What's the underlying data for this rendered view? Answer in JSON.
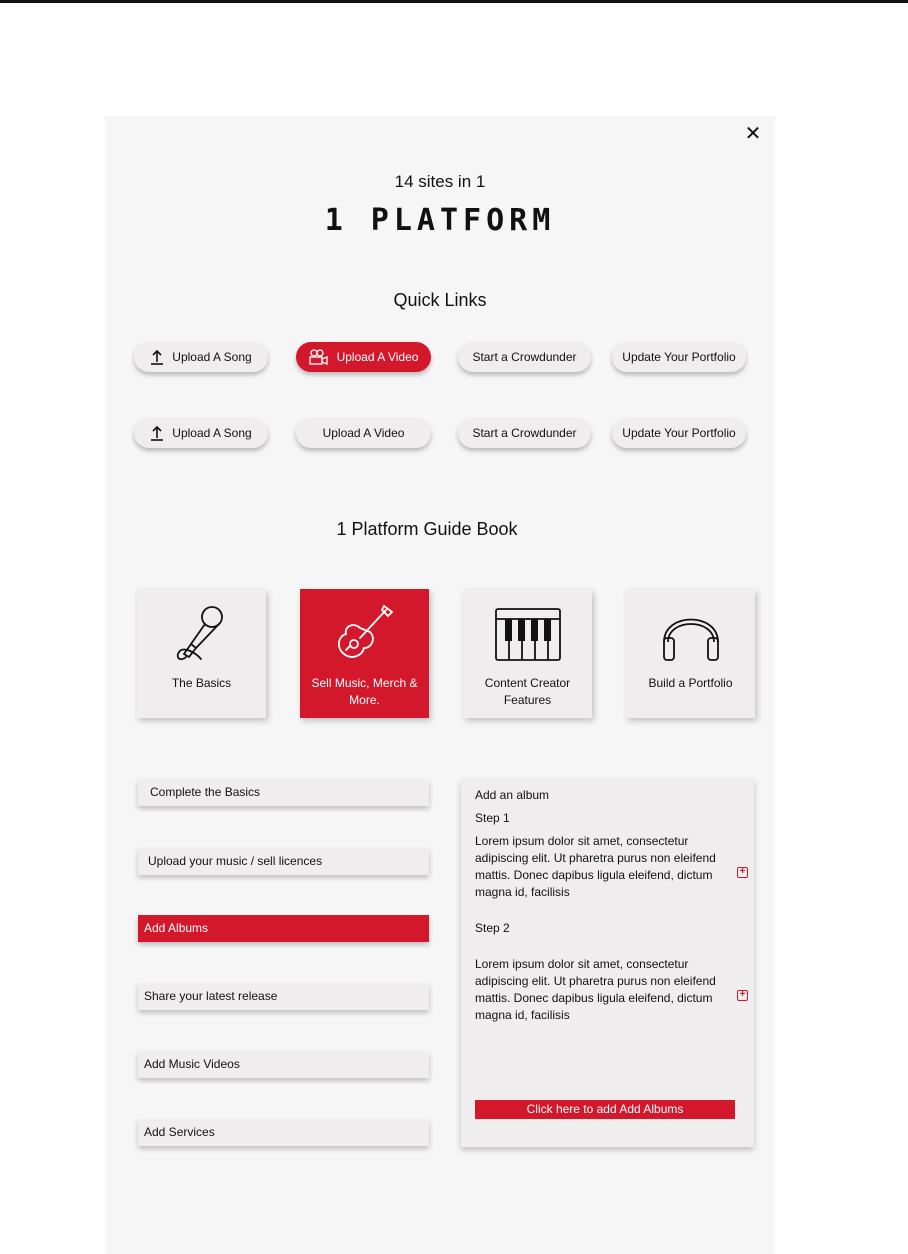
{
  "header": {
    "tagline": "14 sites in 1",
    "logo_text": "1 PLATFORM",
    "close_label": "✕"
  },
  "quick_links": {
    "title": "Quick Links",
    "row1": [
      {
        "label": "Upload A Song",
        "icon": "upload-icon"
      },
      {
        "label": "Upload A Video",
        "icon": "video-camera-icon",
        "active": true
      },
      {
        "label": "Start a Crowdunder"
      },
      {
        "label": "Update Your Portfolio"
      }
    ],
    "row2": [
      {
        "label": "Upload A Song",
        "icon": "upload-icon"
      },
      {
        "label": "Upload A Video"
      },
      {
        "label": "Start a Crowdunder"
      },
      {
        "label": "Update Your Portfolio"
      }
    ]
  },
  "guide": {
    "title": "1 Platform Guide Book",
    "cards": [
      {
        "label": "The Basics",
        "icon": "microphone-icon"
      },
      {
        "label": "Sell Music, Merch & More.",
        "icon": "guitar-icon",
        "active": true
      },
      {
        "label": "Content Creator Features",
        "icon": "piano-keys-icon"
      },
      {
        "label": "Build a Portfolio",
        "icon": "headphones-icon"
      }
    ]
  },
  "steps_menu": [
    {
      "label": "Complete the Basics"
    },
    {
      "label": "Upload your music / sell licences"
    },
    {
      "label": "Add Albums",
      "active": true
    },
    {
      "label": "Share your latest release"
    },
    {
      "label": "Add Music Videos"
    },
    {
      "label": "Add Services"
    }
  ],
  "detail": {
    "title": "Add an album",
    "step1_label": "Step 1",
    "step1_text": "Lorem ipsum dolor sit amet, consectetur adipiscing elit. Ut pharetra purus non eleifend mattis. Donec dapibus ligula eleifend, dictum magna id, facilisis",
    "step2_label": "Step 2",
    "step2_text": "Lorem ipsum dolor sit amet, consectetur adipiscing elit. Ut pharetra purus non eleifend mattis. Donec dapibus ligula eleifend, dictum magna id, facilisis",
    "expand_symbol": "+",
    "cta_label": "Click here to add Add Albums"
  },
  "colors": {
    "accent": "#d3182c",
    "modal_bg": "#f7f6f6",
    "card_bg": "#efeded"
  }
}
